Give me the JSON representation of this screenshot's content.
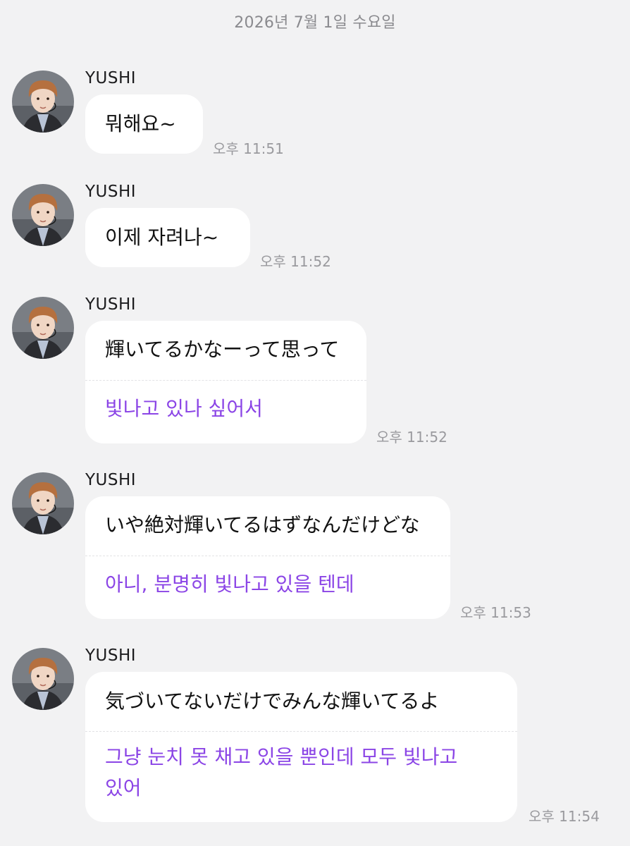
{
  "date_divider": "2026년 7월 1일 수요일",
  "messages": [
    {
      "sender": "YUSHI",
      "text": "뭐해요~",
      "time": "오후 11:51"
    },
    {
      "sender": "YUSHI",
      "text": "이제 자려나~",
      "time": "오후 11:52"
    },
    {
      "sender": "YUSHI",
      "text": "輝いてるかなーって思って",
      "translation": "빛나고 있나 싶어서",
      "time": "오후 11:52"
    },
    {
      "sender": "YUSHI",
      "text": "いや絶対輝いてるはずなんだけどな",
      "translation": "아니, 분명히 빛나고 있을 텐데",
      "time": "오후 11:53"
    },
    {
      "sender": "YUSHI",
      "text": "気づいてないだけでみんな輝いてるよ",
      "translation_line1": "그냥 눈치 못 채고 있을 뿐인데 모두 빛나고",
      "translation_line2": "있어",
      "time": "오후 11:54"
    }
  ],
  "colors": {
    "background": "#f2f2f3",
    "bubble": "#ffffff",
    "translation_text": "#8b45e6",
    "timestamp": "#9a9a9e"
  },
  "icons": {
    "avatar": "profile-photo"
  }
}
